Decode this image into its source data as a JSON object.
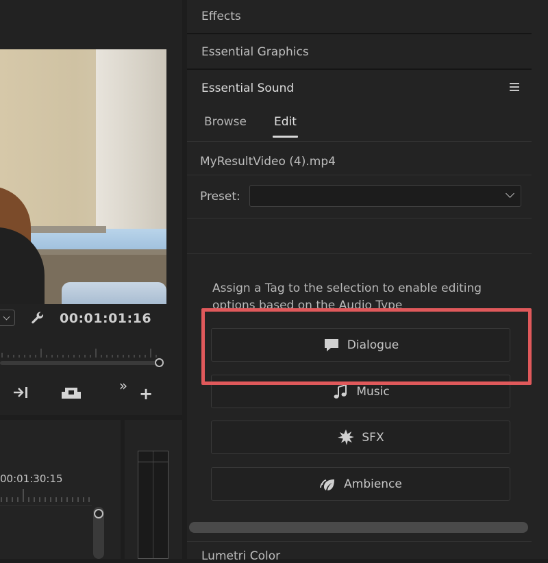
{
  "program_monitor": {
    "timecode": "00:01:01:16",
    "icons": [
      "wrench-icon",
      "insert-icon",
      "export-frame-icon",
      "more-icon",
      "add-icon"
    ],
    "more_glyph": "»",
    "add_glyph": "+"
  },
  "timeline": {
    "timecode": "00:01:30:15"
  },
  "panels": {
    "effects": "Effects",
    "essential_graphics": "Essential Graphics",
    "essential_sound": "Essential Sound",
    "lumetri_color": "Lumetri Color"
  },
  "essential_sound": {
    "tabs": [
      "Browse",
      "Edit"
    ],
    "active_tab": "Edit",
    "clip_name": "MyResultVideo (4).mp4",
    "preset_label": "Preset:",
    "preset_value": "",
    "assign_text": "Assign a Tag to the selection to enable editing options based on the Audio Type",
    "tags": [
      {
        "label": "Dialogue",
        "icon": "speech-bubble-icon"
      },
      {
        "label": "Music",
        "icon": "music-note-icon"
      },
      {
        "label": "SFX",
        "icon": "burst-icon"
      },
      {
        "label": "Ambience",
        "icon": "leaf-icon"
      }
    ]
  },
  "colors": {
    "highlight": "#e0595b",
    "panel_bg": "#232323",
    "app_bg": "#1d1d1d"
  }
}
